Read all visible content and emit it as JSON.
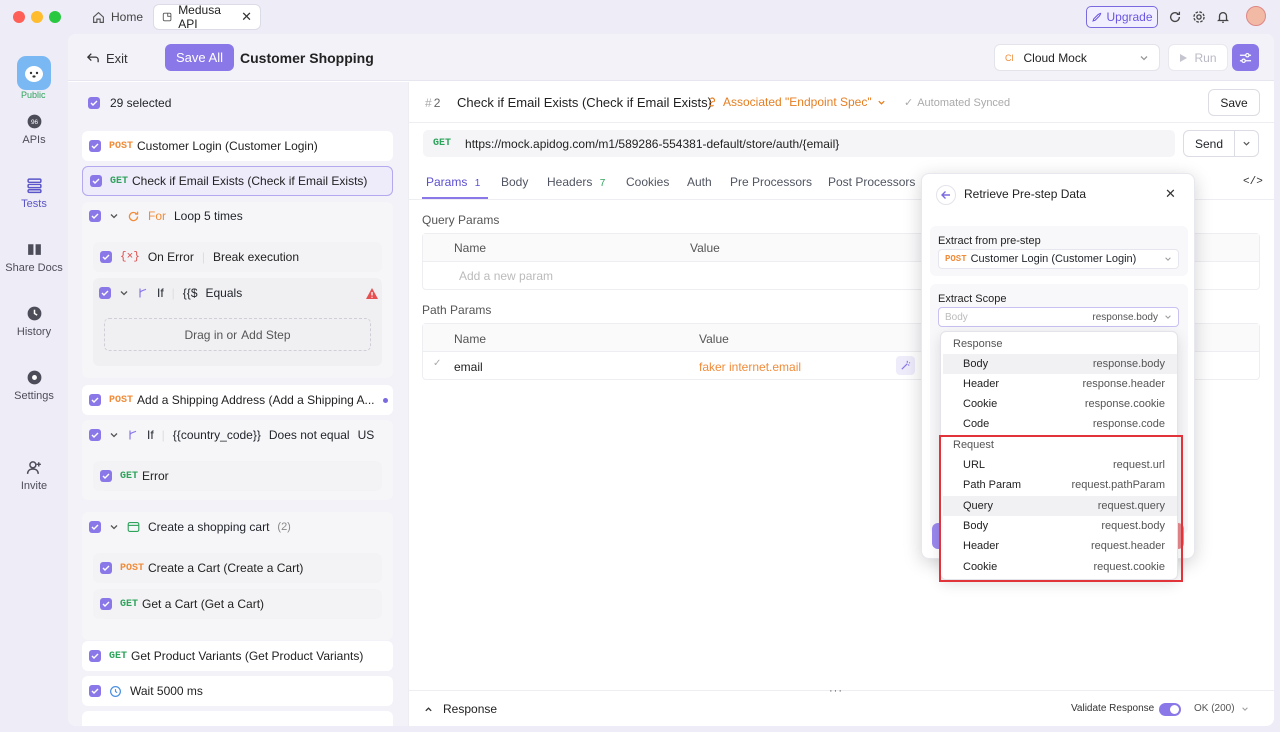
{
  "titlebar": {
    "tabs": [
      {
        "label": "Home"
      },
      {
        "label": "Medusa API"
      }
    ],
    "upgrade_label": "Upgrade"
  },
  "rail": {
    "public_label": "Public",
    "items": [
      {
        "label": "APIs",
        "icon": "api-icon"
      },
      {
        "label": "Tests",
        "icon": "tests-icon"
      },
      {
        "label": "Share Docs",
        "icon": "book-icon"
      },
      {
        "label": "History",
        "icon": "clock-icon"
      },
      {
        "label": "Settings",
        "icon": "gear-icon"
      },
      {
        "label": "Invite",
        "icon": "add-user-icon"
      }
    ]
  },
  "toolbar": {
    "exit_label": "Exit",
    "save_all_label": "Save All",
    "title": "Customer Shopping",
    "env_badge": "Cl",
    "env_label": "Cloud Mock",
    "run_label": "Run"
  },
  "left": {
    "selected_count": "29 selected",
    "steps": {
      "login": {
        "method": "POST",
        "label": "Customer Login (Customer Login)"
      },
      "check": {
        "method": "GET",
        "label": "Check if Email Exists (Check if Email Exists)"
      },
      "loop": {
        "keyword": "For",
        "label": "Loop 5 times"
      },
      "on_error": {
        "label": "On Error",
        "value": "Break execution"
      },
      "if1": {
        "keyword": "If",
        "var": "{{$",
        "op": "Equals"
      },
      "drag": {
        "text": "Drag in or",
        "link": "Add Step"
      },
      "shipping": {
        "method": "POST",
        "label": "Add a Shipping Address (Add a Shipping A..."
      },
      "if2": {
        "keyword": "If",
        "var": "{{country_code}}",
        "op": "Does not equal",
        "value": "US"
      },
      "error": {
        "method": "GET",
        "label": "Error"
      },
      "cart_group": {
        "label": "Create a shopping cart",
        "count": "(2)"
      },
      "create_cart": {
        "method": "POST",
        "label": "Create a Cart (Create a Cart)"
      },
      "get_cart": {
        "method": "GET",
        "label": "Get a Cart (Get a Cart)"
      },
      "variants": {
        "method": "GET",
        "label": "Get Product Variants (Get Product Variants)"
      },
      "wait": {
        "label": "Wait 5000 ms"
      }
    }
  },
  "request": {
    "step_number": "2",
    "name": "Check if Email Exists (Check if Email Exists)",
    "associated": "Associated \"Endpoint Spec\"",
    "synced": "Automated Synced",
    "save_label": "Save",
    "method": "GET",
    "url": "https://mock.apidog.com/m1/589286-554381-default/store/auth/{email}",
    "send_label": "Send",
    "tabs": [
      {
        "label": "Params",
        "count": "1"
      },
      {
        "label": "Body",
        "count": ""
      },
      {
        "label": "Headers",
        "count": "7"
      },
      {
        "label": "Cookies",
        "count": ""
      },
      {
        "label": "Auth",
        "count": ""
      },
      {
        "label": "Pre Processors",
        "count": ""
      },
      {
        "label": "Post Processors",
        "count": ""
      }
    ],
    "query_params_title": "Query Params",
    "path_params_title": "Path Params",
    "col_name": "Name",
    "col_value": "Value",
    "add_param_placeholder": "Add a new param",
    "path_param": {
      "name": "email",
      "value": "faker internet.email"
    }
  },
  "response_bar": {
    "label": "Response",
    "validate_label": "Validate Response",
    "status": "OK (200)"
  },
  "popup": {
    "title": "Retrieve Pre-step Data",
    "extract_from_label": "Extract from pre-step",
    "pre_step": {
      "method": "POST",
      "label": "Customer Login (Customer Login)"
    },
    "scope_label": "Extract Scope",
    "scope_value": "Body",
    "scope_path": "response.body",
    "dropdown": {
      "response_header": "Response",
      "response_items": [
        {
          "key": "Body",
          "path": "response.body"
        },
        {
          "key": "Header",
          "path": "response.header"
        },
        {
          "key": "Cookie",
          "path": "response.cookie"
        },
        {
          "key": "Code",
          "path": "response.code"
        }
      ],
      "request_header": "Request",
      "request_items": [
        {
          "key": "URL",
          "path": "request.url"
        },
        {
          "key": "Path Param",
          "path": "request.pathParam"
        },
        {
          "key": "Query",
          "path": "request.query"
        },
        {
          "key": "Body",
          "path": "request.body"
        },
        {
          "key": "Header",
          "path": "request.header"
        },
        {
          "key": "Cookie",
          "path": "request.cookie"
        }
      ]
    }
  },
  "colors": {
    "accent": "#8b78e8",
    "post": "#f08c3a",
    "get": "#2ea35b",
    "highlight_box": "#e0333a"
  }
}
